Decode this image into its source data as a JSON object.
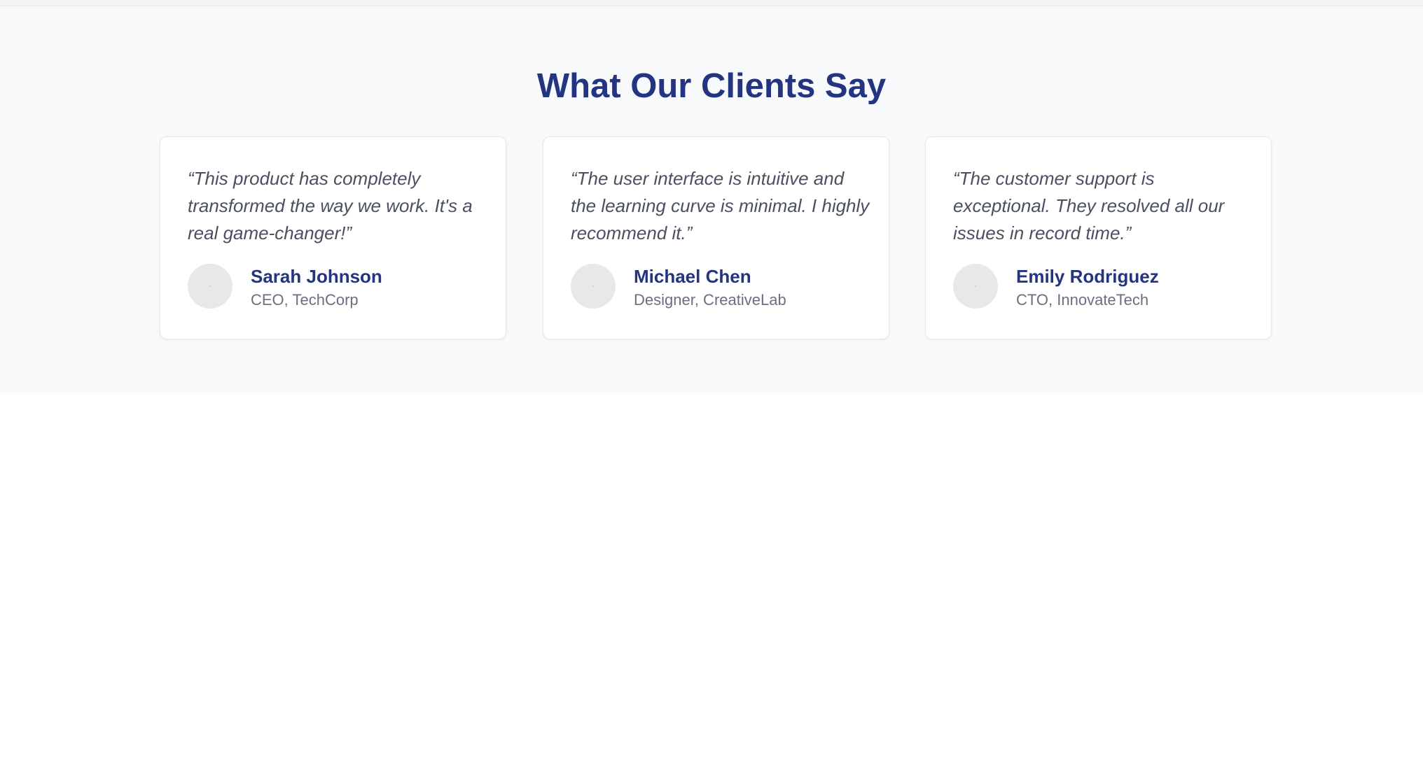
{
  "section": {
    "title": "What Our Clients Say"
  },
  "testimonials": [
    {
      "quote": "“This product has completely transformed the way we work. It's a real game-changer!”",
      "name": "Sarah Johnson",
      "role": "CEO, TechCorp"
    },
    {
      "quote": "“The user interface is intuitive and the learning curve is minimal. I highly recommend it.”",
      "name": "Michael Chen",
      "role": "Designer, CreativeLab"
    },
    {
      "quote": "“The customer support is exceptional. They resolved all our issues in record time.”",
      "name": "Emily Rodriguez",
      "role": "CTO, InnovateTech"
    }
  ],
  "colors": {
    "accent": "#233480",
    "section_background": "#f8f9fb",
    "card_background": "#ffffff",
    "quote_text": "#4b5060",
    "role_text": "#6b7080",
    "avatar_placeholder": "#e7e8ea"
  }
}
